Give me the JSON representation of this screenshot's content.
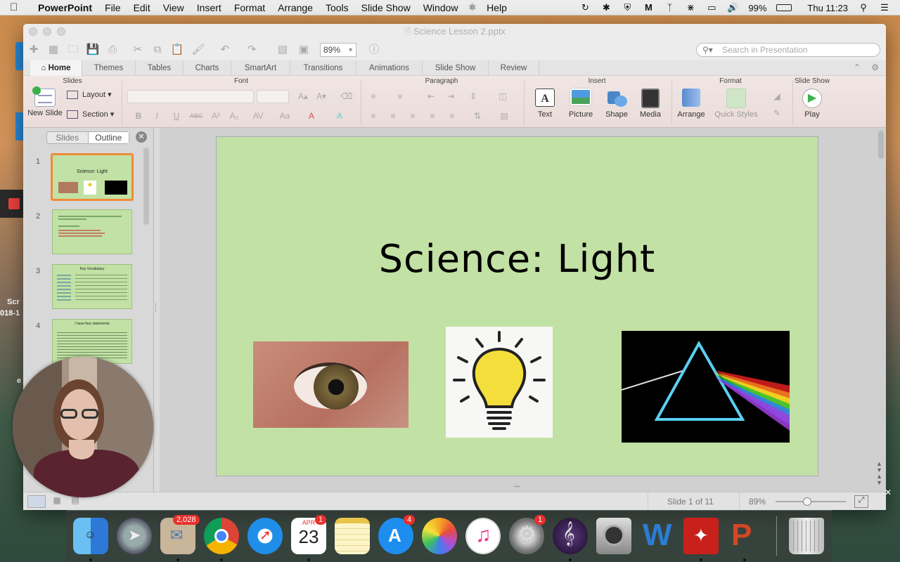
{
  "menubar": {
    "app_name": "PowerPoint",
    "items": [
      "File",
      "Edit",
      "View",
      "Insert",
      "Format",
      "Arrange",
      "Tools",
      "Slide Show",
      "Window",
      "Help"
    ],
    "battery": "99%",
    "clock": "Thu 11:23"
  },
  "desktop": {
    "labels": [
      "Scr",
      "018-1",
      "e"
    ]
  },
  "window": {
    "title": "Science Lesson 2.pptx",
    "zoom": "89%",
    "search_placeholder": "Search in Presentation"
  },
  "ribbon": {
    "tabs": [
      "Home",
      "Themes",
      "Tables",
      "Charts",
      "SmartArt",
      "Transitions",
      "Animations",
      "Slide Show",
      "Review"
    ],
    "groups": {
      "slides": "Slides",
      "font": "Font",
      "paragraph": "Paragraph",
      "insert": "Insert",
      "format": "Format",
      "slideshow": "Slide Show"
    },
    "buttons": {
      "new_slide": "New Slide",
      "layout": "Layout",
      "section": "Section",
      "text": "Text",
      "picture": "Picture",
      "shape": "Shape",
      "media": "Media",
      "arrange": "Arrange",
      "quick_styles": "Quick Styles",
      "play": "Play"
    }
  },
  "left_pane": {
    "tabs": [
      "Slides",
      "Outline"
    ],
    "slides": [
      {
        "num": "1",
        "title": "Science: Light"
      },
      {
        "num": "2"
      },
      {
        "num": "3",
        "title": "Key Vocabulary"
      },
      {
        "num": "4",
        "title": "I have four statements"
      }
    ]
  },
  "slide": {
    "title": "Science: Light"
  },
  "status": {
    "slide_counter": "Slide 1 of 11",
    "zoom": "89%",
    "zoom_level_pct": 45
  },
  "dock": {
    "apps": [
      "Finder",
      "Launchpad",
      "Mail",
      "Chrome",
      "Safari",
      "Calendar",
      "Notes",
      "App Store",
      "Photos",
      "iTunes",
      "System Preferences",
      "Music Theory",
      "Disk Utility",
      "Word",
      "Acrobat",
      "PowerPoint",
      "Trash"
    ],
    "badges": {
      "mail": "2,028",
      "calendar": "1",
      "appstore": "4",
      "sysprefs": "1"
    },
    "calendar": {
      "month": "APR",
      "day": "23"
    }
  },
  "colors": {
    "slide_bg": "#c2e1a4",
    "selection": "#f08a3a",
    "play_green": "#3cb04a"
  }
}
